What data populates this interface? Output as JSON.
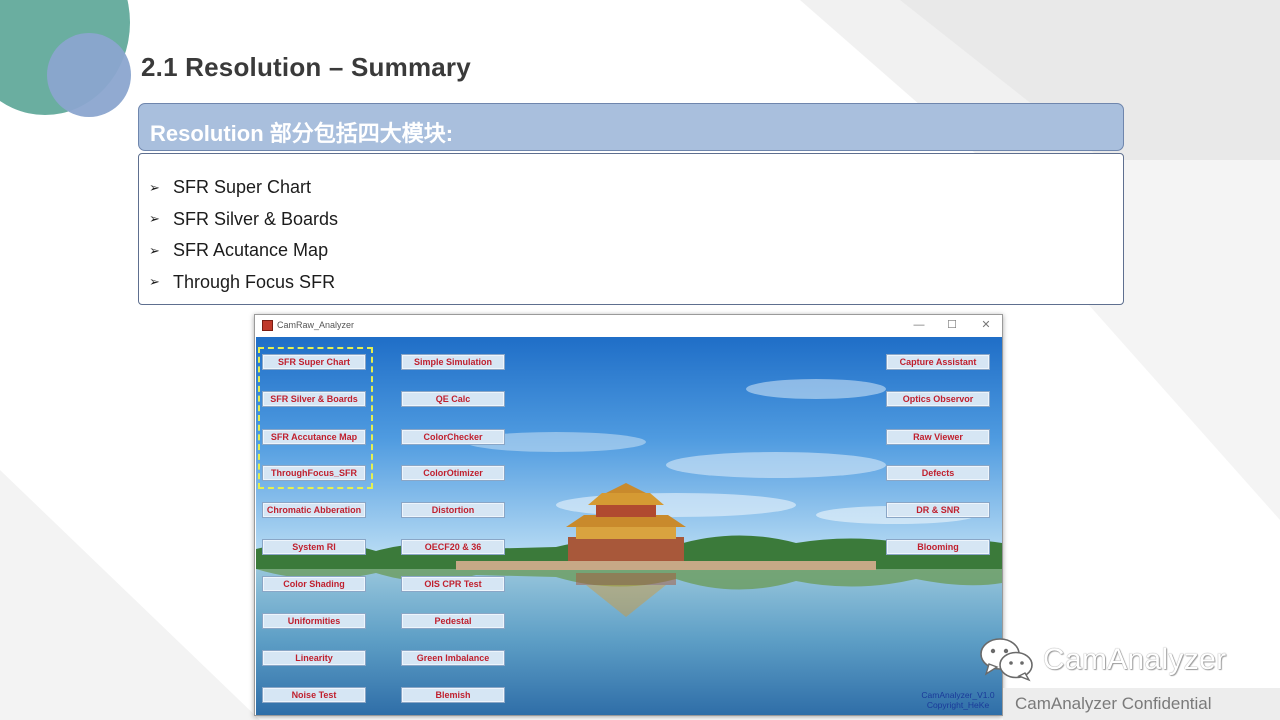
{
  "slide": {
    "title": "2.1  Resolution – Summary",
    "section_header": "Resolution 部分包括四大模块:",
    "bullets": [
      "SFR Super Chart",
      "SFR Silver & Boards",
      "SFR Acutance Map",
      "Through Focus SFR"
    ]
  },
  "app": {
    "title": "CamRaw_Analyzer",
    "window_controls": {
      "minimize": "—",
      "maximize": "☐",
      "close": "✕"
    },
    "left_column": [
      "SFR Super Chart",
      "SFR Silver & Boards",
      "SFR Accutance Map",
      "ThroughFocus_SFR",
      "Chromatic Abberation",
      "System RI",
      "Color Shading",
      "Uniformities",
      "Linearity",
      "Noise Test"
    ],
    "middle_column": [
      "Simple Simulation",
      "QE Calc",
      "ColorChecker",
      "ColorOtimizer",
      "Distortion",
      "OECF20 & 36",
      "OIS CPR Test",
      "Pedestal",
      "Green Imbalance",
      "Blemish"
    ],
    "right_column": [
      "Capture Assistant",
      "Optics Observor",
      "Raw Viewer",
      "Defects",
      "DR & SNR",
      "Blooming"
    ],
    "version_line1": "CamAnalyzer_V1.0",
    "version_line2": "Copyright_HeKe"
  },
  "watermark": {
    "name": "CamAnalyzer",
    "confidential": "CamAnalyzer  Confidential"
  },
  "colors": {
    "header_fill": "#a9bfdd",
    "button_fill": "#d6e6f4",
    "button_text": "#c0202e",
    "highlight": "#e4ef50"
  }
}
